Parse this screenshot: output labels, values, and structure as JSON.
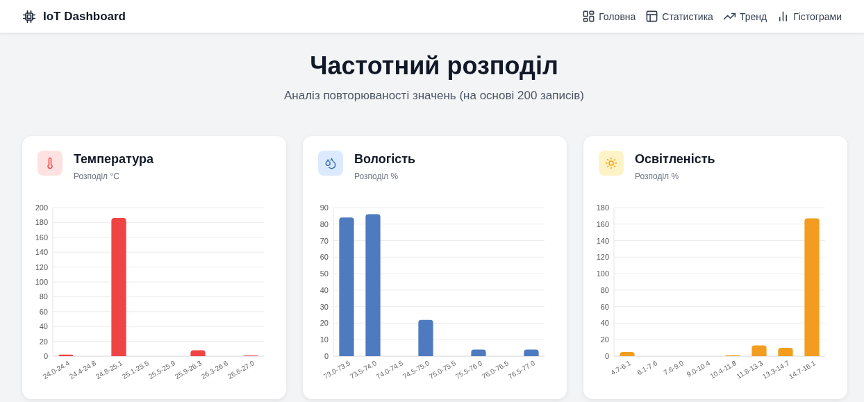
{
  "header": {
    "title": "IoT Dashboard",
    "nav": [
      {
        "kind": "grid",
        "label": "Головна"
      },
      {
        "kind": "table",
        "label": "Статистика"
      },
      {
        "kind": "trend",
        "label": "Тренд"
      },
      {
        "kind": "bars",
        "label": "Гістограми"
      }
    ]
  },
  "page": {
    "title": "Частотний розподіл",
    "subtitle": "Аналіз повторюваності значень (на основі 200 записів)"
  },
  "cards": [
    {
      "kind": "temperature",
      "title": "Температура",
      "subtitle": "Розподіл °C",
      "chart_data": {
        "type": "bar",
        "categories": [
          "24.0-24.4",
          "24.4-24.8",
          "24.8-25.1",
          "25.1-25.5",
          "25.5-25.9",
          "25.9-26.3",
          "26.3-26.6",
          "26.6-27.0"
        ],
        "grid": true,
        "series": [
          {
            "color": "#ef4444",
            "values": [
              2,
              0,
              186,
              0,
              0,
              8,
              0,
              1
            ]
          }
        ],
        "ylim": [
          0,
          200
        ],
        "yticks": [
          0,
          20,
          40,
          60,
          80,
          100,
          120,
          140,
          160,
          180,
          200
        ]
      }
    },
    {
      "kind": "humidity",
      "title": "Вологість",
      "subtitle": "Розподіл %",
      "chart_data": {
        "type": "bar",
        "categories": [
          "73.0-73.5",
          "73.5-74.0",
          "74.0-74.5",
          "74.5-75.0",
          "75.0-75.5",
          "75.5-76.0",
          "76.0-76.5",
          "76.5-77.0"
        ],
        "grid": true,
        "series": [
          {
            "color": "#4e7bbf",
            "values": [
              84,
              86,
              0,
              22,
              0,
              4,
              0,
              4
            ]
          }
        ],
        "ylim": [
          0,
          90
        ],
        "yticks": [
          0,
          10,
          20,
          30,
          40,
          50,
          60,
          70,
          80,
          90
        ]
      }
    },
    {
      "kind": "light",
      "title": "Освітленість",
      "subtitle": "Розподіл %",
      "chart_data": {
        "type": "bar",
        "categories": [
          "4.7-6.1",
          "6.1-7.6",
          "7.6-9.0",
          "9.0-10.4",
          "10.4-11.8",
          "11.8-13.3",
          "13.3-14.7",
          "14.7-16.1"
        ],
        "grid": true,
        "series": [
          {
            "color": "#f29d1f",
            "values": [
              5,
              0,
              0,
              0,
              1,
              13,
              10,
              167
            ]
          }
        ],
        "ylim": [
          0,
          180
        ],
        "yticks": [
          0,
          20,
          40,
          60,
          80,
          100,
          120,
          140,
          160,
          180
        ]
      }
    }
  ]
}
